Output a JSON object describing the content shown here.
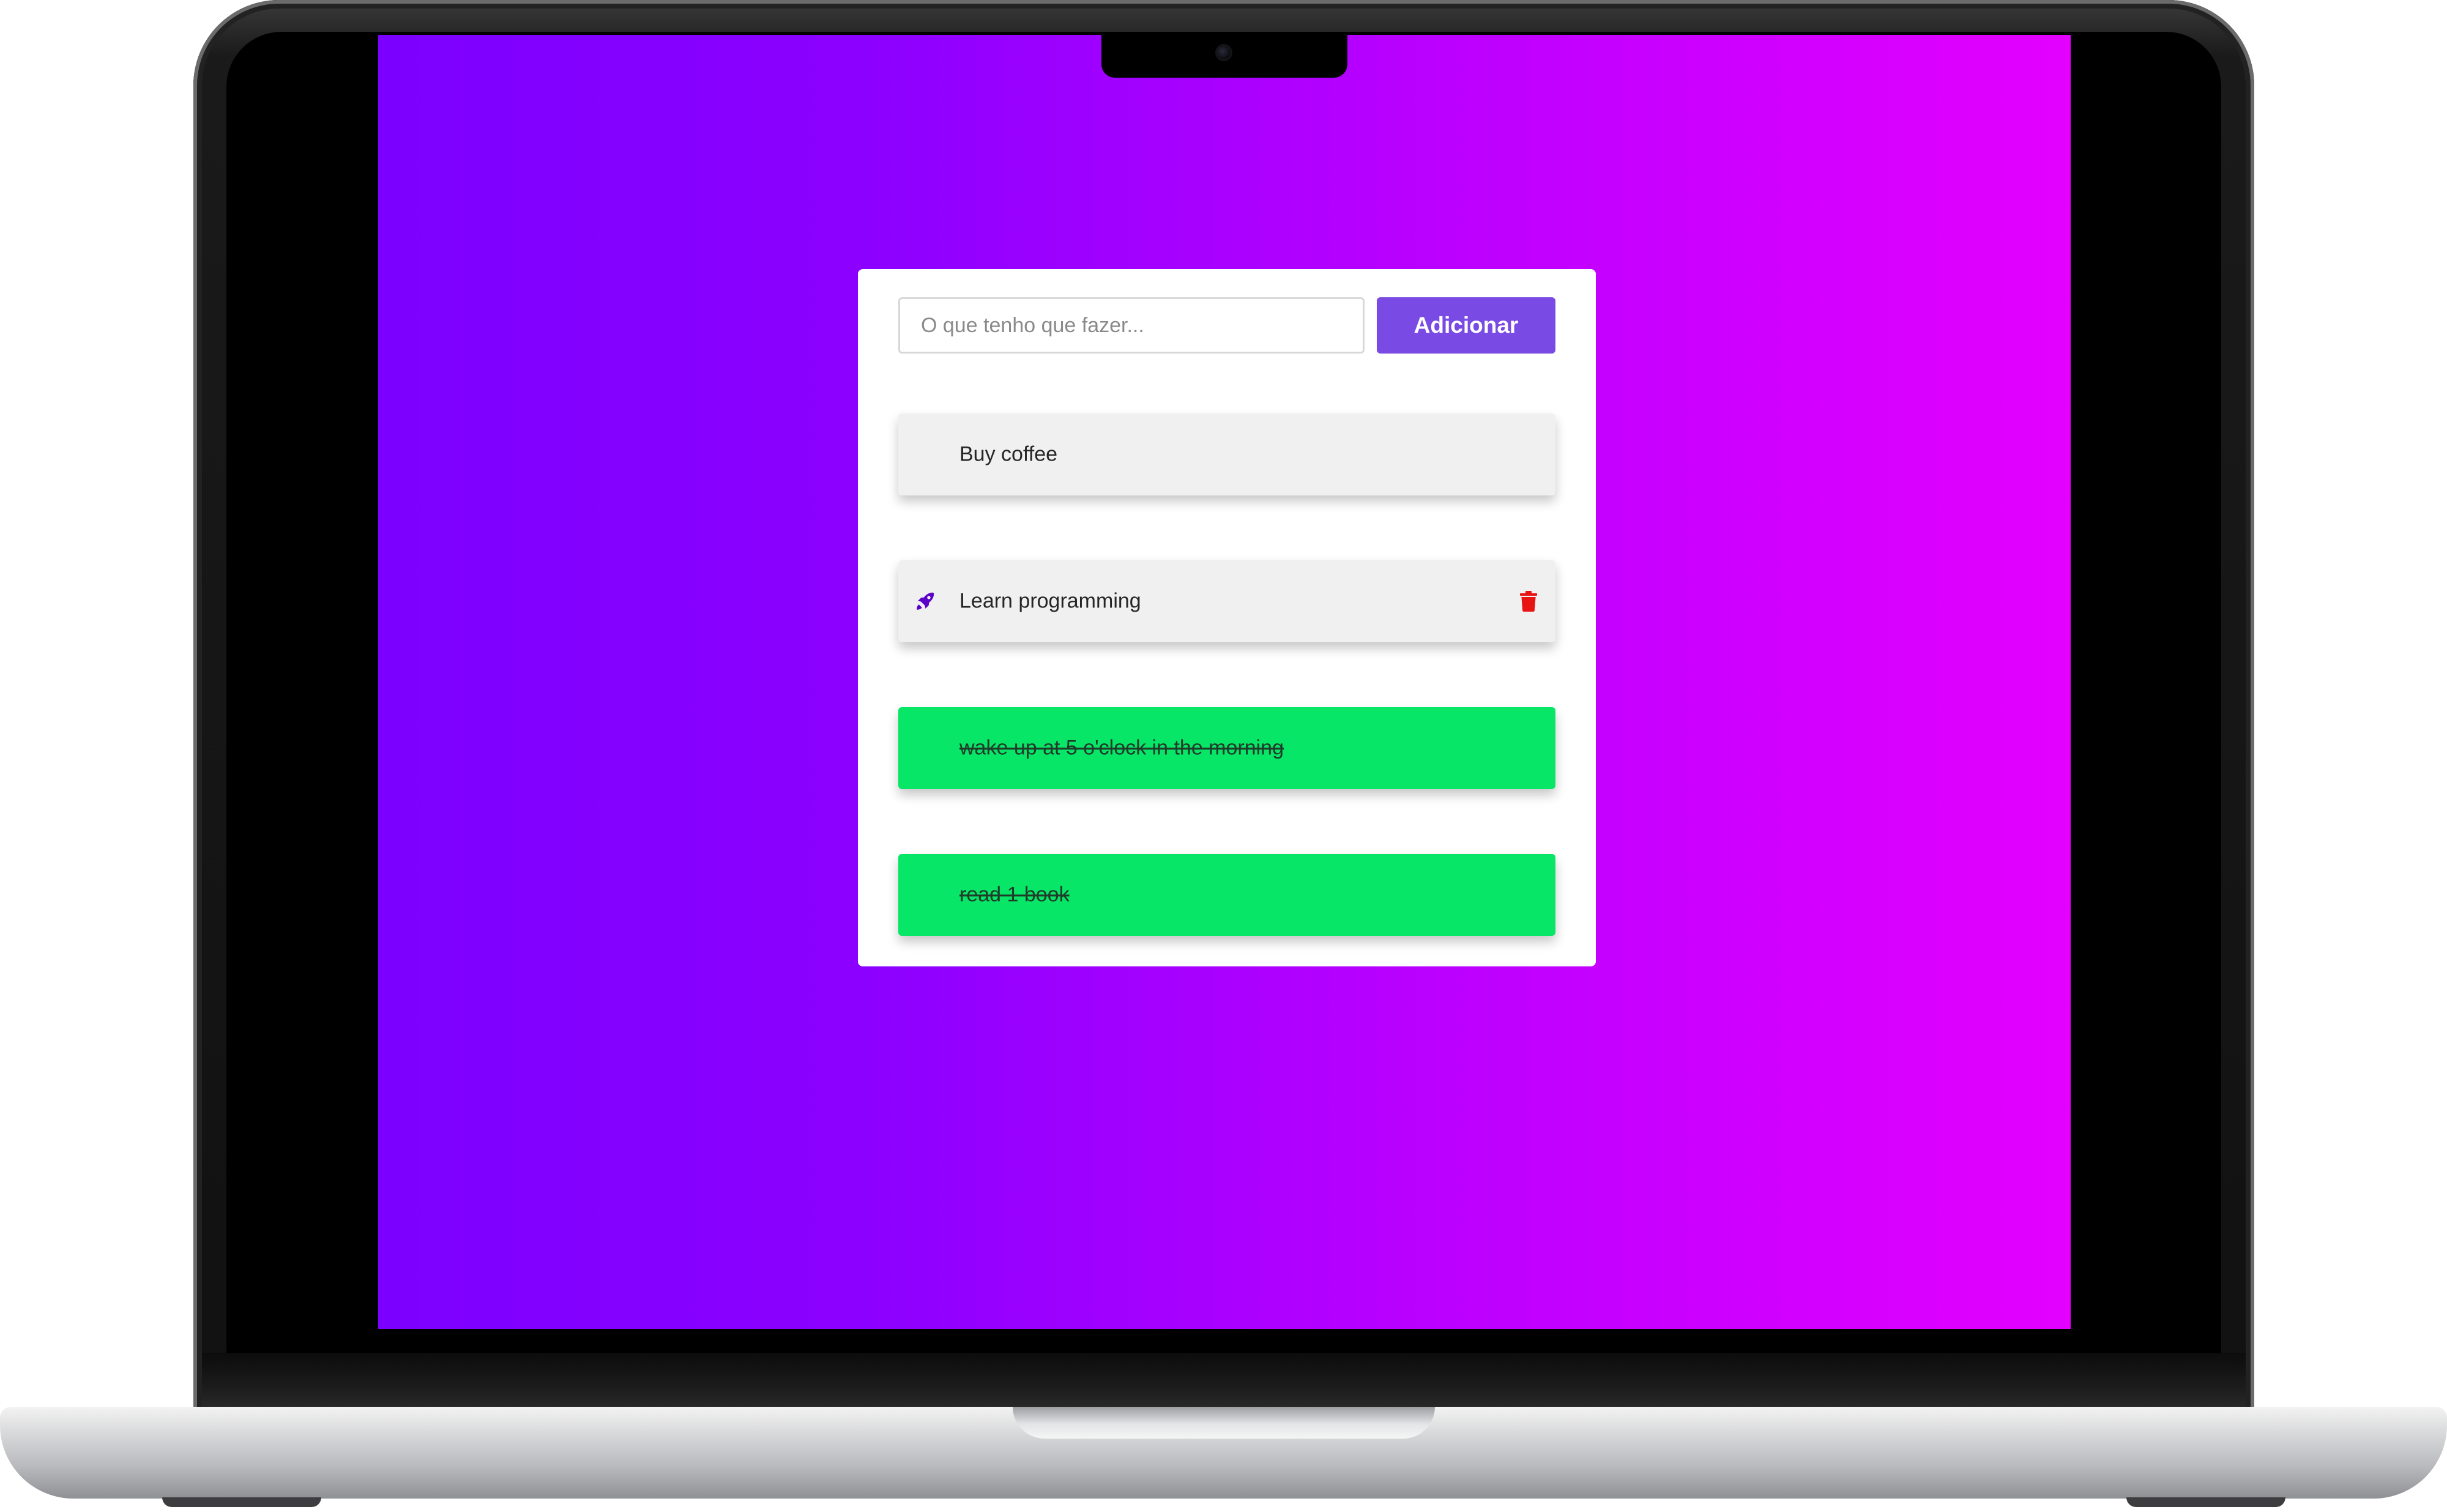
{
  "colors": {
    "screen_gradient_start": "#7c00ff",
    "screen_gradient_end": "#e300ff",
    "accent_button": "#7a4ae4",
    "task_done": "#08e667",
    "task_pending": "#f0f0f0",
    "delete_icon": "#e81414",
    "rocket_icon": "#5a00c8"
  },
  "todo": {
    "input": {
      "placeholder": "O que tenho que fazer...",
      "value": ""
    },
    "add_button_label": "Adicionar",
    "tasks": [
      {
        "label": "Buy coffee",
        "done": false,
        "hovered": false
      },
      {
        "label": "Learn programming",
        "done": false,
        "hovered": true,
        "icons": [
          "rocket-icon",
          "trash-icon"
        ]
      },
      {
        "label": "wake up at 5 o'clock in the morning",
        "done": true,
        "hovered": false
      },
      {
        "label": "read 1 book",
        "done": true,
        "hovered": false
      }
    ]
  }
}
